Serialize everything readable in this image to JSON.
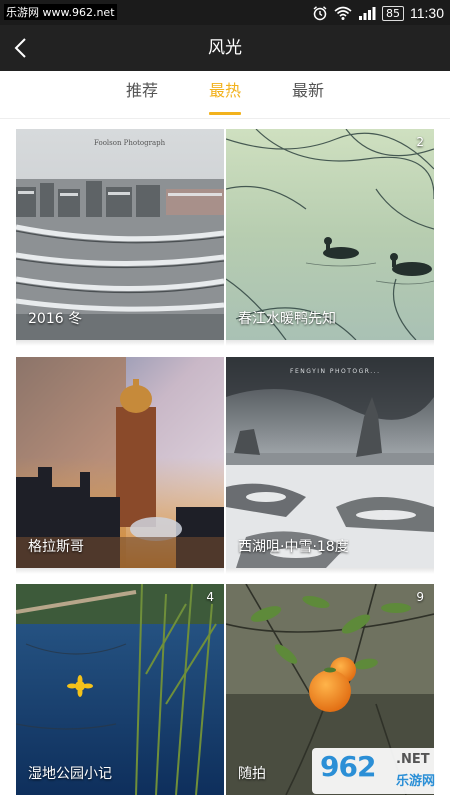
{
  "status_bar": {
    "watermark_text": "乐游网 www.962.net",
    "battery": "85",
    "time": "11:30",
    "icons": [
      "alarm-icon",
      "wifi-icon",
      "signal-icon",
      "battery-icon"
    ]
  },
  "header": {
    "title": "风光",
    "back_icon": "chevron-left-icon"
  },
  "tabs": [
    {
      "label": "推荐",
      "active": false
    },
    {
      "label": "最热",
      "active": true
    },
    {
      "label": "最新",
      "active": false
    }
  ],
  "cards": [
    {
      "title": "2016 冬",
      "count": "",
      "photo_text": "Foolson Photograph"
    },
    {
      "title": "春江水暖鸭先知",
      "count": "2",
      "photo_text": ""
    },
    {
      "title": "格拉斯哥",
      "count": "",
      "photo_text": ""
    },
    {
      "title": "西湖咀·中雪·18度",
      "count": "",
      "photo_text": "FENGYIN PHOTOGR..."
    },
    {
      "title": "湿地公园小记",
      "count": "4",
      "photo_text": ""
    },
    {
      "title": "随拍",
      "count": "9",
      "photo_text": ""
    }
  ],
  "watermark_logo": {
    "digits": "962",
    "net": ".NET",
    "cn": "乐游网"
  },
  "colors": {
    "accent": "#f2b21d",
    "header_bg": "#222222",
    "status_bg": "#1b1b1b"
  }
}
